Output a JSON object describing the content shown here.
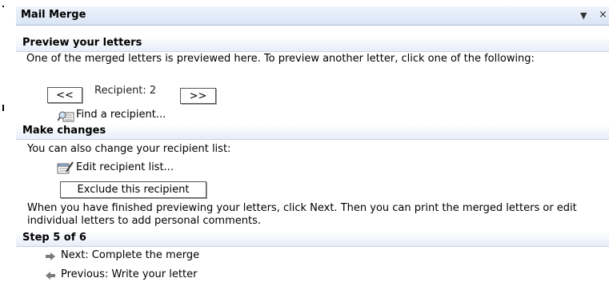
{
  "pane": {
    "title": "Mail Merge",
    "dropdown_glyph": "▼",
    "close_glyph": "×"
  },
  "preview": {
    "heading": "Preview your letters",
    "description": "One of the merged letters is previewed here. To preview another letter, click one of the following:",
    "prev_label": "<<",
    "recipient_label": "Recipient: 2",
    "next_label": ">>",
    "find_label": "Find a recipient..."
  },
  "changes": {
    "heading": "Make changes",
    "description": "You can also change your recipient list:",
    "edit_label": "Edit recipient list...",
    "exclude_label": "Exclude this recipient",
    "finish_text": "When you have finished previewing your letters, click Next. Then you can print the merged letters or edit individual letters to add personal comments."
  },
  "step": {
    "heading": "Step 5 of 6",
    "next_label": "Next: Complete the merge",
    "previous_label": "Previous: Write your letter"
  },
  "icons": {
    "find": "find-recipient-icon",
    "edit": "edit-list-icon",
    "next": "right-arrow-icon",
    "previous": "left-arrow-icon"
  }
}
